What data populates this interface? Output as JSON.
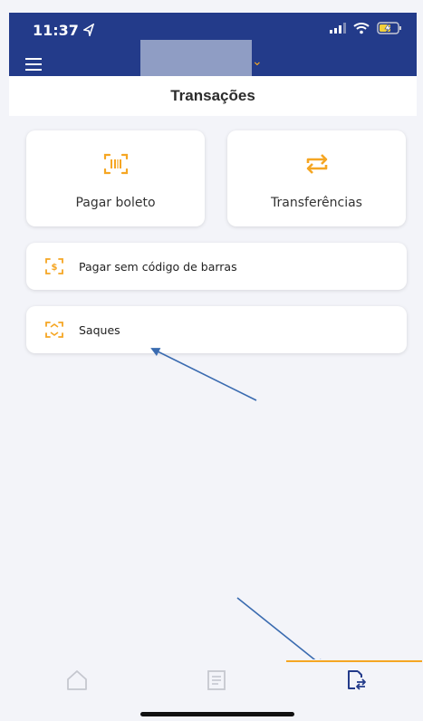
{
  "status_bar": {
    "time": "11:37",
    "icons": [
      "location-arrow-icon",
      "signal-icon",
      "wifi-icon",
      "battery-charging-icon"
    ]
  },
  "header": {
    "menu_icon": "hamburger-icon",
    "account_dropdown_icon": "chevron-down-icon"
  },
  "page": {
    "title": "Transações"
  },
  "actions": {
    "tiles": [
      {
        "label": "Pagar boleto",
        "icon": "barcode-scan-icon"
      },
      {
        "label": "Transferências",
        "icon": "transfer-arrows-icon"
      }
    ],
    "rows": [
      {
        "label": "Pagar sem código de barras",
        "icon": "money-scan-icon"
      },
      {
        "label": "Saques",
        "icon": "cash-withdraw-icon"
      }
    ]
  },
  "tab_bar": {
    "tabs": [
      {
        "icon": "home-icon",
        "active": false
      },
      {
        "icon": "receipt-icon",
        "active": false
      },
      {
        "icon": "transactions-icon",
        "active": true
      }
    ]
  },
  "colors": {
    "header_bg": "#233b8a",
    "accent": "#f5a623",
    "page_bg": "#f3f4f9",
    "annotation_arrow": "#3a6bb0"
  }
}
